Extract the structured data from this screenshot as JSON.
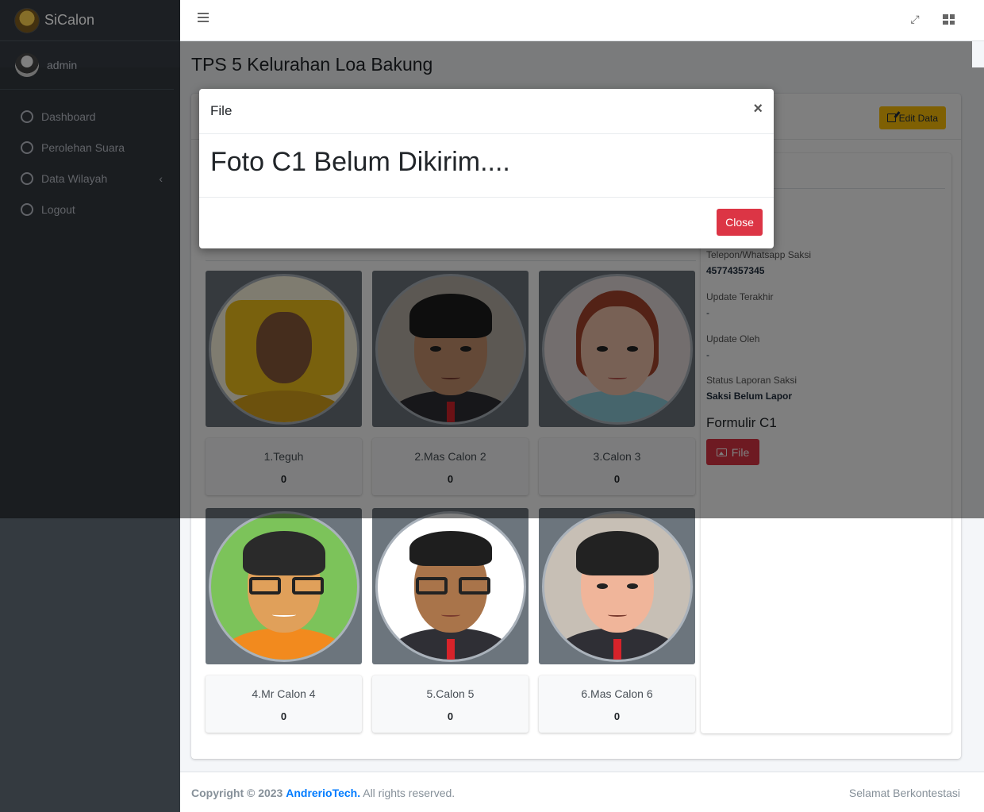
{
  "brand": {
    "name": "SiCalon"
  },
  "user": {
    "name": "admin"
  },
  "sidebar": {
    "items": [
      {
        "label": "Dashboard"
      },
      {
        "label": "Perolehan Suara"
      },
      {
        "label": "Data Wilayah"
      },
      {
        "label": "Logout"
      }
    ]
  },
  "page": {
    "title": "TPS 5 Kelurahan Loa Bakung"
  },
  "card": {
    "edit_label": "Edit Data"
  },
  "info": {
    "phone_label": "Telepon/Whatsapp Saksi",
    "phone_value": "45774357345",
    "updated_label": "Update Terakhir",
    "updated_value": "-",
    "updated_by_label": "Update Oleh",
    "updated_by_value": "-",
    "status_label": "Status Laporan Saksi",
    "status_value": "Saksi Belum Lapor",
    "form_title": "Formulir C1",
    "file_label": "File"
  },
  "candidates": [
    {
      "name": "1.Teguh",
      "votes": "0"
    },
    {
      "name": "2.Mas Calon 2",
      "votes": "0"
    },
    {
      "name": "3.Calon 3",
      "votes": "0"
    },
    {
      "name": "4.Mr Calon 4",
      "votes": "0"
    },
    {
      "name": "5.Calon 5",
      "votes": "0"
    },
    {
      "name": "6.Mas Calon 6",
      "votes": "0"
    }
  ],
  "footer": {
    "copyright": "Copyright © 2023",
    "company": "AndrerioTech.",
    "rights": "All rights reserved.",
    "right_text": "Selamat Berkontestasi"
  },
  "modal": {
    "title": "File",
    "message": "Foto C1 Belum Dikirim....",
    "close_x": "×",
    "close_label": "Close"
  },
  "colors": {
    "sidebar_bg": "#343a40",
    "danger": "#dc3545",
    "warning": "#ffc107",
    "primary": "#007bff"
  }
}
